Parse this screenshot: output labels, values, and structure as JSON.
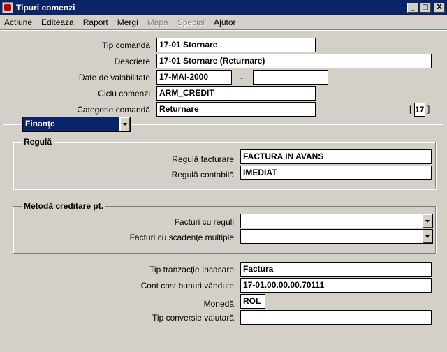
{
  "window": {
    "title": "Tipuri comenzi",
    "min": "_",
    "max": "□",
    "close": "X"
  },
  "menu": [
    {
      "label": "Actiune",
      "disabled": false
    },
    {
      "label": "Editeaza",
      "disabled": false
    },
    {
      "label": "Raport",
      "disabled": false
    },
    {
      "label": "Mergi",
      "disabled": false
    },
    {
      "label": "Mapa",
      "disabled": true
    },
    {
      "label": "Special",
      "disabled": true
    },
    {
      "label": "Ajutor",
      "disabled": false
    }
  ],
  "header": {
    "tip_comanda": {
      "label": "Tip comandă",
      "value": "17-01 Stornare"
    },
    "descriere": {
      "label": "Descriere",
      "value": "17-01 Stornare (Returnare)"
    },
    "date_valabilitate": {
      "label": "Date de valabilitate",
      "from": "17-MAI-2000",
      "sep": "-",
      "to": ""
    },
    "ciclu_comenzi": {
      "label": "Ciclu comenzi",
      "value": "ARM_CREDIT"
    },
    "categorie": {
      "label": "Categorie comandă",
      "value": "Returnare"
    },
    "counter": {
      "open": "[",
      "value": "17",
      "close": "]"
    }
  },
  "tab_selector": {
    "value": "Finanţe"
  },
  "regula": {
    "title": "Regulă",
    "facturare": {
      "label": "Regulă facturare",
      "value": "FACTURA IN AVANS"
    },
    "contabila": {
      "label": "Regulă contabilă",
      "value": "IMEDIAT"
    }
  },
  "metoda": {
    "title": "Metodă creditare pt.",
    "facturi_reguli": {
      "label": "Facturi cu reguli",
      "value": ""
    },
    "facturi_scadente": {
      "label": "Facturi cu scadenţe multiple",
      "value": ""
    }
  },
  "bottom": {
    "tranzactie": {
      "label": "Tip tranzacţie încasare",
      "value": "Factura"
    },
    "cont_cost": {
      "label": "Cont cost bunuri vândute",
      "value": "17-01.00.00.00.70111"
    },
    "moneda": {
      "label": "Monedă",
      "value": "ROL"
    },
    "conversie": {
      "label": "Tip conversie valutară",
      "value": ""
    }
  }
}
